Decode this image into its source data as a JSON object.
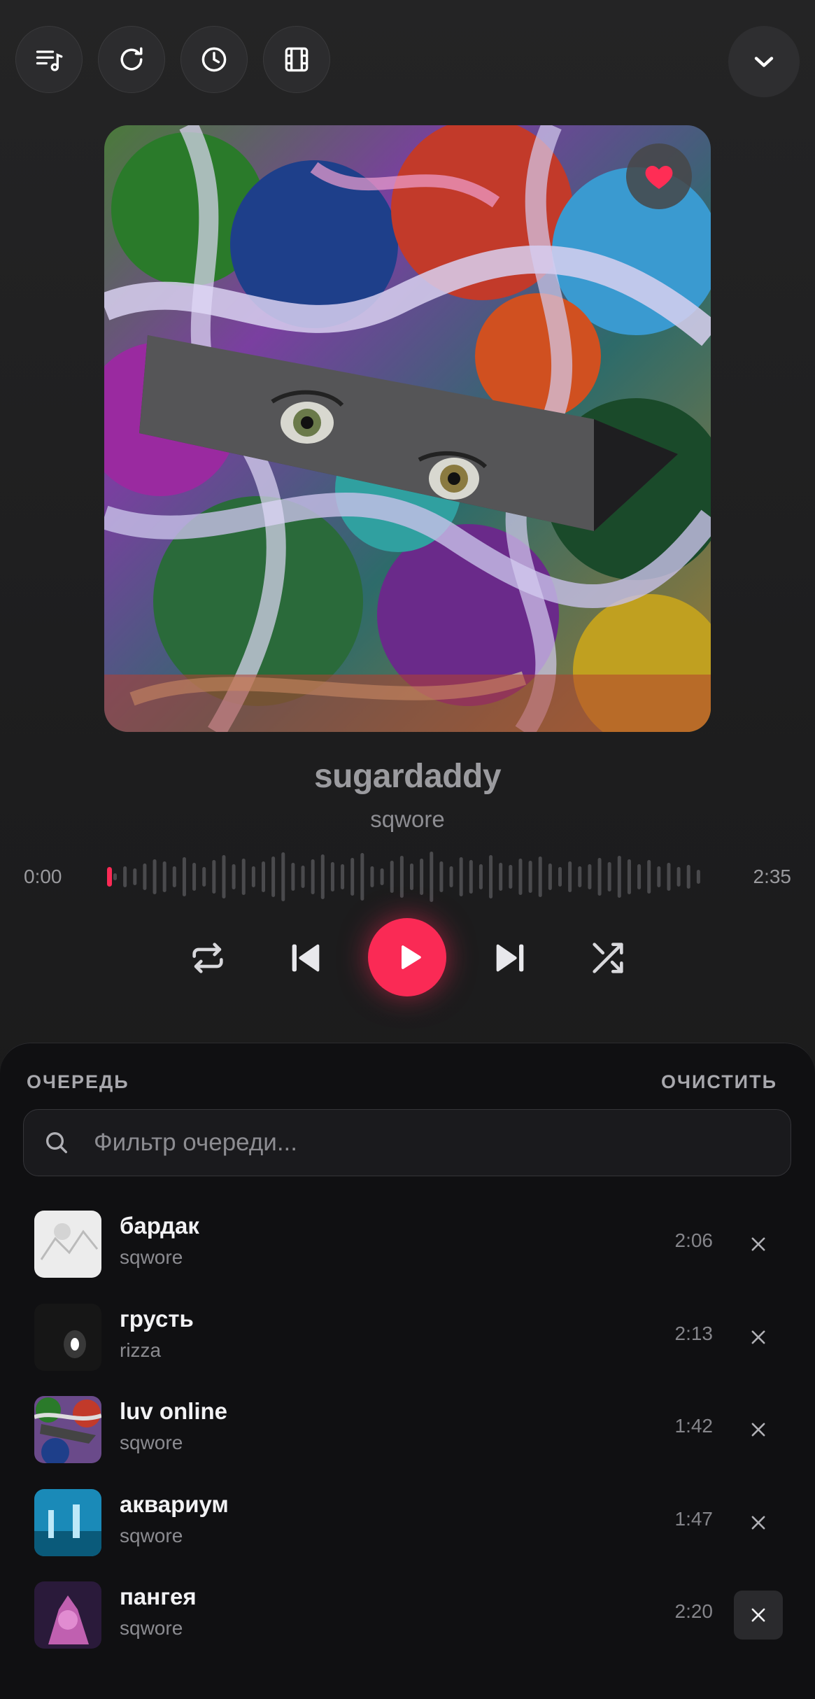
{
  "toolbar": {
    "buttons": [
      "lyrics-icon",
      "refresh-icon",
      "history-icon",
      "film-icon"
    ],
    "collapse_icon": "chevron-down-icon"
  },
  "now_playing": {
    "title": "sugardaddy",
    "artist": "sqwore",
    "current_time": "0:00",
    "duration": "2:35",
    "progress": 0,
    "liked": true
  },
  "colors": {
    "accent": "#fa2a55",
    "background": "#1f1f20",
    "queue_bg": "#101012"
  },
  "queue": {
    "title": "ОЧЕРЕДЬ",
    "clear_label": "ОЧИСТИТЬ",
    "filter_placeholder": "Фильтр очереди...",
    "items": [
      {
        "title": "бардак",
        "artist": "sqwore",
        "duration": "2:06"
      },
      {
        "title": "грусть",
        "artist": "rizza",
        "duration": "2:13"
      },
      {
        "title": "luv online",
        "artist": "sqwore",
        "duration": "1:42"
      },
      {
        "title": "аквариум",
        "artist": "sqwore",
        "duration": "1:47"
      },
      {
        "title": "пангея",
        "artist": "sqwore",
        "duration": "2:20"
      }
    ]
  }
}
